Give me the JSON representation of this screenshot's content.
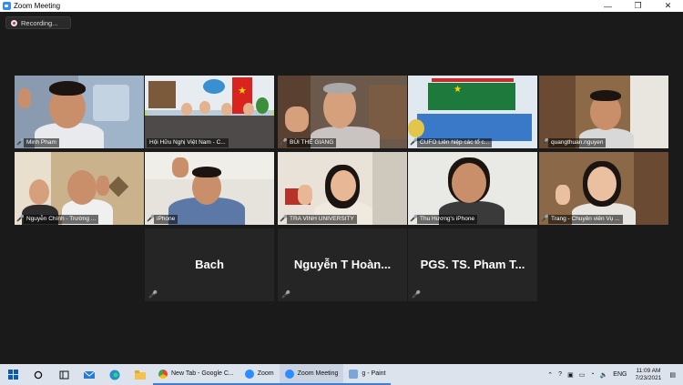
{
  "window": {
    "title": "Zoom Meeting",
    "minimize": "—",
    "maximize": "❐",
    "close": "✕"
  },
  "recording": {
    "label": "Recording..."
  },
  "participants": [
    {
      "name": "Minh Pham",
      "muted": true
    },
    {
      "name": "Hội Hữu Nghị Việt Nam - C...",
      "muted": false,
      "active_speaker": true
    },
    {
      "name": "BÙI THẾ GIANG",
      "muted": true
    },
    {
      "name": "CUFO Liên hiệp các tổ c...",
      "muted": true
    },
    {
      "name": "quangthuan.nguyen",
      "muted": true
    },
    {
      "name": "Nguyễn Chính - Trường ...",
      "muted": true
    },
    {
      "name": "iPhone",
      "muted": true
    },
    {
      "name": "TRA VINH UNIVERSITY",
      "muted": true
    },
    {
      "name": "Thu Hương's iPhone",
      "muted": true
    },
    {
      "name": "Trang - Chuyên viên Vụ ...",
      "muted": true
    },
    {
      "name": "Bach",
      "muted": true,
      "video_off": true
    },
    {
      "name": "Nguyễn T Hoàn...",
      "muted": true,
      "video_off": true
    },
    {
      "name": "PGS. TS. Pham T...",
      "muted": true,
      "video_off": true
    }
  ],
  "taskbar": {
    "apps": [
      {
        "label": "New Tab - Google C...",
        "icon": "chrome-icon",
        "color": "#e94235"
      },
      {
        "label": "Zoom",
        "icon": "zoom-icon",
        "color": "#2d8cff"
      },
      {
        "label": "Zoom Meeting",
        "icon": "zoom-meeting-icon",
        "color": "#2d8cff"
      },
      {
        "label": "g - Paint",
        "icon": "paint-icon",
        "color": "#7aa6d8"
      }
    ],
    "language": "ENG",
    "time": "11:09 AM",
    "date": "7/23/2021"
  },
  "colors": {
    "active_speaker_border": "#c8d948",
    "muted_mic": "#e23b3b",
    "zoom_blue": "#2d8cff"
  }
}
